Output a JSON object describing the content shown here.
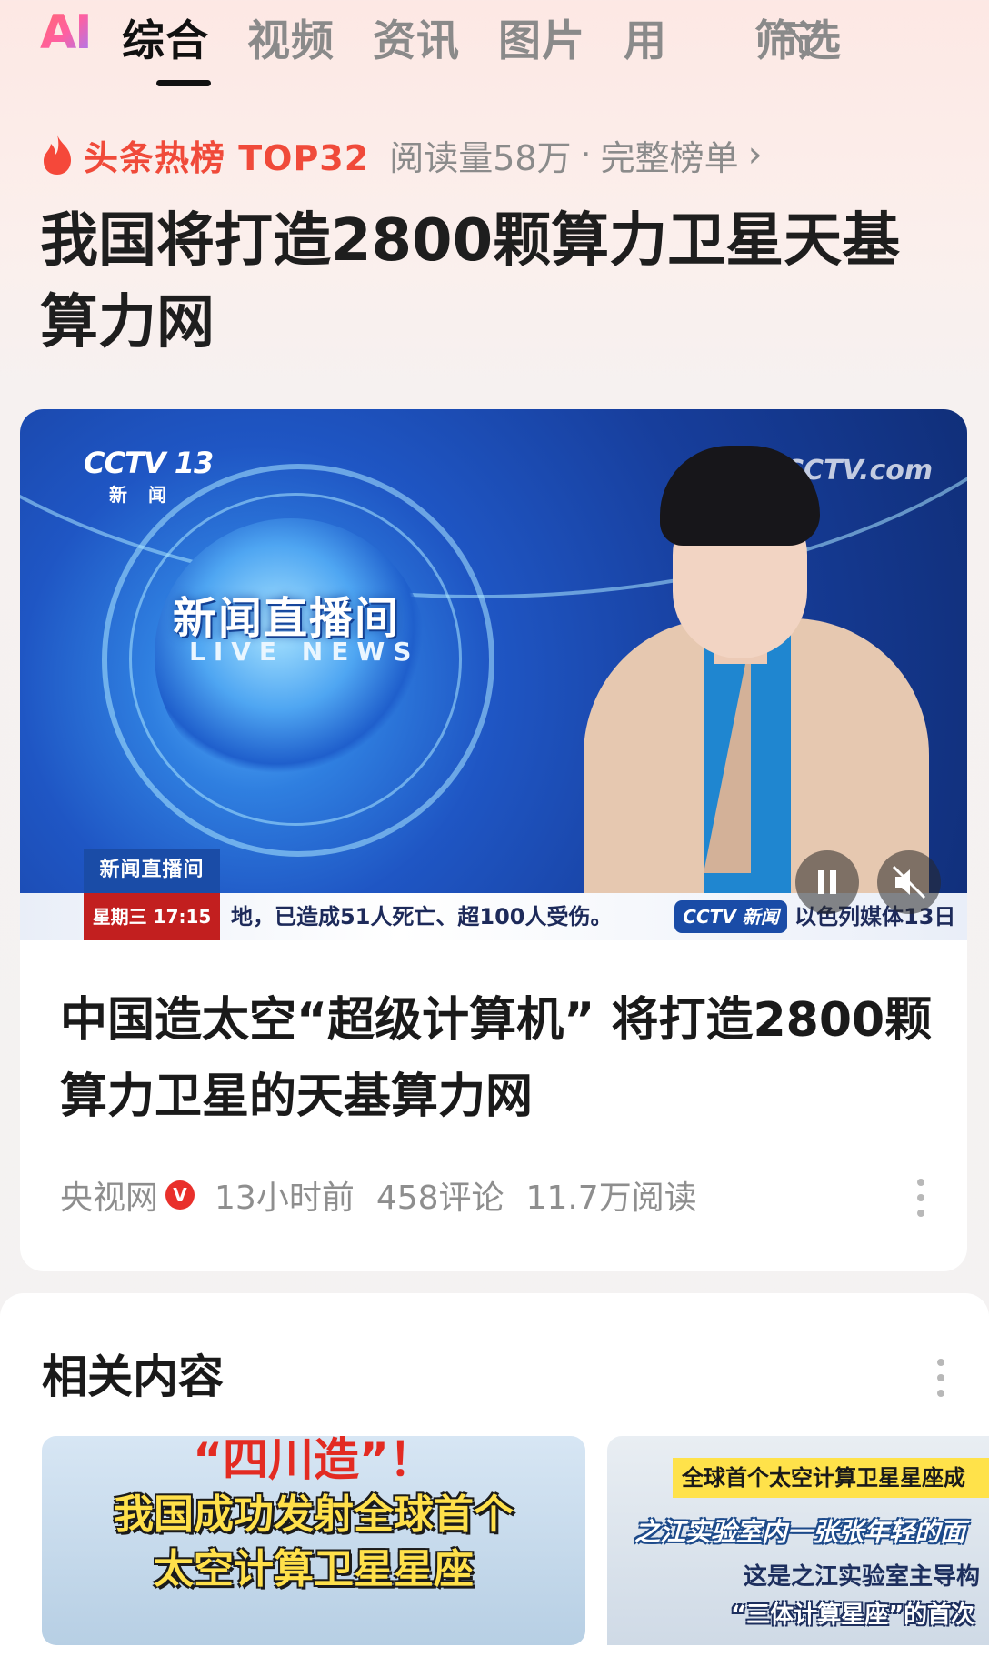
{
  "tabs": {
    "ai_label": "AI",
    "items": [
      {
        "label": "综合",
        "active": true
      },
      {
        "label": "视频",
        "active": false
      },
      {
        "label": "资讯",
        "active": false
      },
      {
        "label": "图片",
        "active": false
      },
      {
        "label": "用",
        "active": false
      }
    ],
    "filter_label": "筛选",
    "filter_icon": "funnel-icon"
  },
  "hot": {
    "icon": "flame-icon",
    "label": "头条热榜 TOP32",
    "reads": "阅读量58万",
    "sep": "·",
    "full_list": "完整榜单",
    "chevron": "›"
  },
  "headline": "我国将打造2800颗算力卫星天基算力网",
  "card": {
    "video": {
      "channel_logo": "CCTV 13",
      "channel_sub": "新 闻",
      "program_title": "新闻直播间",
      "program_sub": "LIVE NEWS",
      "watermark": "CCTV.com",
      "ticker_logo": "新闻直播间",
      "ticker_time": "星期三  17:15",
      "ticker_text": "地，已造成51人死亡、超100人受伤。",
      "ticker_cctv": "CCTV 新闻",
      "ticker_text2": "以色列媒体13日",
      "pause_icon": "pause-icon",
      "mute_icon": "mute-icon"
    },
    "title": "中国造太空“超级计算机” 将打造2800颗算力卫星的天基算力网",
    "source": "央视网",
    "verified": "V",
    "time": "13小时前",
    "comments": "458评论",
    "reads": "11.7万阅读"
  },
  "related": {
    "title": "相关内容",
    "thumb1": {
      "line1": "“四川造”！",
      "line2": "我国成功发射全球首个",
      "line3": "太空计算卫星星座"
    },
    "thumb2": {
      "line1": "全球首个太空计算卫星星座成",
      "line2": "之江实验室内一张张年轻的面",
      "line3": "这是之江实验室主导构",
      "line4": "“三体计算星座”的首次"
    }
  },
  "colors": {
    "accent_red": "#f04a3a",
    "muted_text": "#8e8e8e",
    "verified_red": "#e9302b"
  }
}
